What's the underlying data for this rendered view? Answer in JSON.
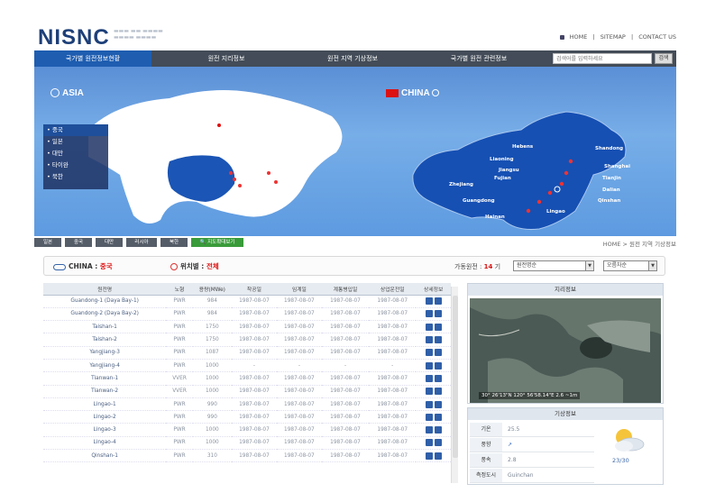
{
  "header": {
    "logo": "NISNC",
    "links": [
      "HOME",
      "SITEMAP",
      "CONTACT US"
    ]
  },
  "nav": {
    "items": [
      "국가별 원전정보현황",
      "원전 지리정보",
      "원전 지역 기상정보",
      "국가별 원전 관련정보"
    ],
    "active_index": 0,
    "search_placeholder": "검색어를 입력하세요",
    "search_button": "검색"
  },
  "banner": {
    "asia_title": "ASIA",
    "china_title": "CHINA",
    "countries": [
      "중국",
      "일본",
      "대만",
      "타이완",
      "북한"
    ],
    "cities": [
      "Hebens",
      "Liaoning",
      "Jiangsu",
      "Fujian",
      "Zhejiang",
      "Guangdong",
      "Hainan",
      "Shandong",
      "Shanghai",
      "Tianjin",
      "Dalian",
      "Qinshan",
      "Lingao"
    ]
  },
  "toolbar": {
    "buttons": [
      "일본",
      "중국",
      "대만",
      "러시아",
      "북한"
    ],
    "map_button": "지도확대보기",
    "breadcrumb": "HOME > 원전 지역 기상정보"
  },
  "filter": {
    "country_label": "CHINA :",
    "country_value": "중국",
    "location_label": "위치별 :",
    "location_value": "전체",
    "count_label": "가동원전 :",
    "count_value": "14",
    "count_unit": "기",
    "select1": "원전명순",
    "select2": "오름차순"
  },
  "table": {
    "headers": [
      "원전명",
      "노형",
      "용량(MWe)",
      "착공일",
      "임계일",
      "계통병입일",
      "상업운전일",
      "상세정보"
    ],
    "rows": [
      [
        "Guandong-1 (Daya Bay-1)",
        "PWR",
        "984",
        "1987-08-07",
        "1987-08-07",
        "1987-08-07",
        "1987-08-07"
      ],
      [
        "Guandong-2 (Daya Bay-2)",
        "PWR",
        "984",
        "1987-08-07",
        "1987-08-07",
        "1987-08-07",
        "1987-08-07"
      ],
      [
        "Taishan-1",
        "PWR",
        "1750",
        "1987-08-07",
        "1987-08-07",
        "1987-08-07",
        "1987-08-07"
      ],
      [
        "Taishan-2",
        "PWR",
        "1750",
        "1987-08-07",
        "1987-08-07",
        "1987-08-07",
        "1987-08-07"
      ],
      [
        "Yangjiang-3",
        "PWR",
        "1087",
        "1987-08-07",
        "1987-08-07",
        "1987-08-07",
        "1987-08-07"
      ],
      [
        "Yangjiang-4",
        "PWR",
        "1000",
        "-",
        "-",
        "-",
        "-"
      ],
      [
        "Tianwan-1",
        "VVER",
        "1000",
        "1987-08-07",
        "1987-08-07",
        "1987-08-07",
        "1987-08-07"
      ],
      [
        "Tianwan-2",
        "VVER",
        "1000",
        "1987-08-07",
        "1987-08-07",
        "1987-08-07",
        "1987-08-07"
      ],
      [
        "Lingao-1",
        "PWR",
        "990",
        "1987-08-07",
        "1987-08-07",
        "1987-08-07",
        "1987-08-07"
      ],
      [
        "Lingao-2",
        "PWR",
        "990",
        "1987-08-07",
        "1987-08-07",
        "1987-08-07",
        "1987-08-07"
      ],
      [
        "Lingao-3",
        "PWR",
        "1000",
        "1987-08-07",
        "1987-08-07",
        "1987-08-07",
        "1987-08-07"
      ],
      [
        "Lingao-4",
        "PWR",
        "1000",
        "1987-08-07",
        "1987-08-07",
        "1987-08-07",
        "1987-08-07"
      ],
      [
        "Qinshan-1",
        "PWR",
        "310",
        "1987-08-07",
        "1987-08-07",
        "1987-08-07",
        "1987-08-07"
      ]
    ]
  },
  "geo_panel": {
    "title": "지리정보",
    "coords": "30° 26'13\"N 120° 56'58.14\"E 2.6 ~1m"
  },
  "weather_panel": {
    "title": "기상정보",
    "rows": [
      {
        "key": "기온",
        "value": "25.5"
      },
      {
        "key": "풍향",
        "value": "↗"
      },
      {
        "key": "풍속",
        "value": "2.8"
      },
      {
        "key": "측정도시",
        "value": "Guinchan"
      }
    ],
    "range": "23/30",
    "icon": "partly-cloudy-icon"
  }
}
